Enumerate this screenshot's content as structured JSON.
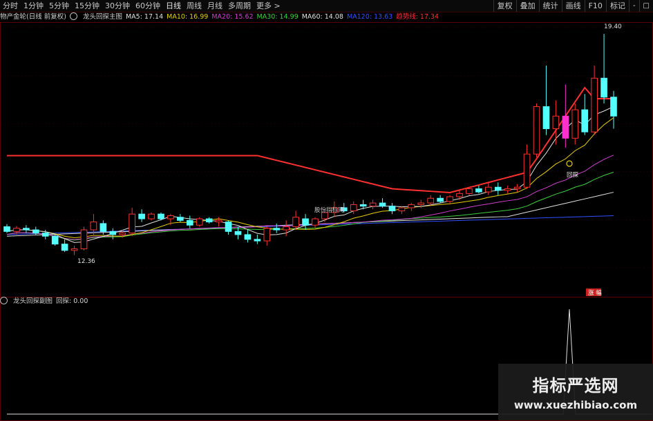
{
  "toolbar": {
    "periods": [
      "分时",
      "1分钟",
      "5分钟",
      "15分钟",
      "30分钟",
      "60分钟",
      "日线",
      "周线",
      "月线",
      "多周期",
      "更多 >"
    ],
    "right_tools": [
      "复权",
      "叠加",
      "统计",
      "画线",
      "F10",
      "标记",
      "-",
      "□"
    ]
  },
  "info": {
    "stock": "物产金轮(日线 前复权)",
    "indicator": "龙头回探主图",
    "ma5": "MA5: 17.14",
    "ma10": "MA10: 16.99",
    "ma20": "MA20: 15.62",
    "ma30": "MA30: 14.99",
    "ma60": "MA60: 14.08",
    "ma120": "MA120: 13.63",
    "ext": "趋势线: 17.34"
  },
  "colors": {
    "ma5": "#e0e0e0",
    "ma10": "#e8d000",
    "ma20": "#d040d0",
    "ma30": "#40d040",
    "ma60": "#e0e0e0",
    "ma120": "#3050ff",
    "trend": "#ff3030",
    "up": "#ff3030",
    "down": "#54ffff",
    "magenta": "#ff30d0"
  },
  "annotations": {
    "high": "19.40",
    "low": "12.36",
    "stock_label": "股份指标网",
    "tan": "回探",
    "bottom_label": "涨 幅"
  },
  "sub": {
    "indicator": "龙头回探副图",
    "value": "回探: 0.00"
  },
  "watermark": {
    "title": "指标严选网",
    "url": "www.xuezhibiao.com"
  },
  "chart_data": {
    "type": "candlestick",
    "ylim": [
      12.0,
      19.6
    ],
    "candles": [
      [
        13.3,
        13.38,
        13.1,
        13.15
      ],
      [
        13.15,
        13.32,
        13.05,
        13.25
      ],
      [
        13.25,
        13.35,
        13.1,
        13.2
      ],
      [
        13.2,
        13.3,
        13.05,
        13.1
      ],
      [
        13.1,
        13.2,
        12.9,
        13.0
      ],
      [
        13.0,
        13.05,
        12.7,
        12.75
      ],
      [
        12.75,
        12.9,
        12.5,
        12.55
      ],
      [
        12.55,
        12.7,
        12.4,
        12.6
      ],
      [
        12.6,
        13.3,
        12.55,
        13.2
      ],
      [
        13.2,
        13.7,
        13.0,
        13.45
      ],
      [
        13.4,
        13.5,
        13.05,
        13.15
      ],
      [
        13.15,
        13.25,
        12.9,
        13.05
      ],
      [
        13.05,
        13.2,
        12.95,
        13.1
      ],
      [
        13.1,
        13.9,
        13.0,
        13.7
      ],
      [
        13.7,
        13.85,
        13.45,
        13.55
      ],
      [
        13.55,
        13.75,
        13.5,
        13.7
      ],
      [
        13.7,
        13.75,
        13.5,
        13.55
      ],
      [
        13.55,
        13.7,
        13.35,
        13.65
      ],
      [
        13.6,
        13.7,
        13.45,
        13.5
      ],
      [
        13.5,
        13.65,
        13.25,
        13.35
      ],
      [
        13.35,
        13.6,
        13.3,
        13.55
      ],
      [
        13.55,
        13.6,
        13.4,
        13.45
      ],
      [
        13.45,
        13.6,
        13.3,
        13.5
      ],
      [
        13.45,
        13.5,
        13.05,
        13.15
      ],
      [
        13.15,
        13.3,
        12.9,
        13.05
      ],
      [
        13.05,
        13.2,
        12.8,
        12.9
      ],
      [
        12.9,
        13.05,
        12.75,
        12.85
      ],
      [
        12.85,
        13.3,
        12.7,
        13.25
      ],
      [
        13.25,
        13.4,
        13.1,
        13.2
      ],
      [
        13.2,
        13.5,
        13.0,
        13.3
      ],
      [
        13.3,
        13.8,
        13.2,
        13.6
      ],
      [
        13.55,
        13.7,
        13.2,
        13.35
      ],
      [
        13.35,
        13.6,
        13.25,
        13.55
      ],
      [
        13.55,
        13.85,
        13.45,
        13.75
      ],
      [
        13.75,
        14.1,
        13.6,
        13.9
      ],
      [
        13.9,
        14.05,
        13.75,
        13.8
      ],
      [
        13.8,
        14.1,
        13.7,
        14.0
      ],
      [
        14.0,
        14.15,
        13.85,
        13.95
      ],
      [
        13.95,
        14.15,
        13.85,
        14.05
      ],
      [
        14.05,
        14.2,
        13.9,
        13.95
      ],
      [
        13.95,
        14.05,
        13.7,
        13.8
      ],
      [
        13.8,
        13.95,
        13.7,
        13.9
      ],
      [
        13.9,
        14.05,
        13.8,
        14.0
      ],
      [
        14.0,
        14.15,
        13.9,
        14.05
      ],
      [
        14.05,
        14.3,
        13.95,
        14.2
      ],
      [
        14.2,
        14.3,
        14.05,
        14.1
      ],
      [
        14.1,
        14.3,
        14.0,
        14.25
      ],
      [
        14.25,
        14.45,
        14.15,
        14.35
      ],
      [
        14.35,
        14.55,
        14.3,
        14.5
      ],
      [
        14.5,
        14.6,
        14.35,
        14.4
      ],
      [
        14.4,
        14.7,
        14.3,
        14.55
      ],
      [
        14.55,
        14.7,
        14.3,
        14.45
      ],
      [
        14.45,
        14.6,
        14.35,
        14.5
      ],
      [
        14.5,
        14.65,
        14.4,
        14.55
      ],
      [
        14.55,
        15.9,
        14.5,
        15.6
      ],
      [
        15.6,
        17.2,
        15.5,
        17.1
      ],
      [
        17.1,
        18.4,
        16.2,
        16.4
      ],
      [
        16.4,
        17.3,
        15.9,
        16.8
      ],
      [
        16.8,
        17.8,
        15.8,
        16.1
      ],
      [
        16.1,
        17.2,
        15.9,
        17.0
      ],
      [
        17.0,
        17.5,
        16.2,
        16.3
      ],
      [
        16.3,
        18.4,
        16.2,
        18.0
      ],
      [
        18.0,
        19.4,
        17.2,
        17.4
      ],
      [
        17.4,
        17.6,
        16.4,
        16.8
      ]
    ]
  }
}
